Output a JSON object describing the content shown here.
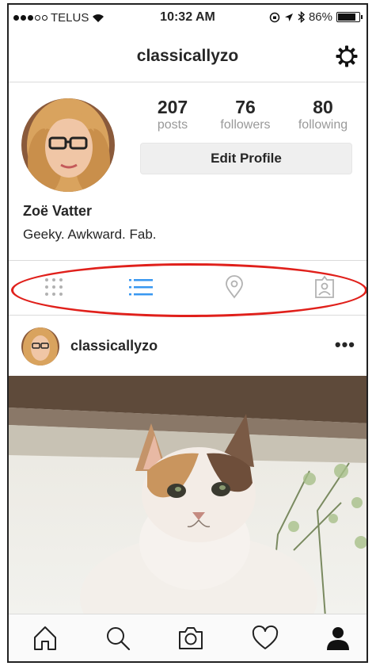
{
  "status_bar": {
    "carrier": "TELUS",
    "signal_bars_filled": 3,
    "signal_bars_total": 5,
    "time": "10:32 AM",
    "battery": "86%",
    "battery_level": 0.86
  },
  "header": {
    "username": "classicallyzo"
  },
  "profile": {
    "stats": [
      {
        "value": "207",
        "label": "posts"
      },
      {
        "value": "76",
        "label": "followers"
      },
      {
        "value": "80",
        "label": "following"
      }
    ],
    "edit_button": "Edit Profile",
    "name": "Zoë Vatter",
    "bio": "Geeky. Awkward. Fab."
  },
  "view_tabs": [
    {
      "icon": "grid-icon",
      "active": false
    },
    {
      "icon": "list-icon",
      "active": true
    },
    {
      "icon": "location-pin-icon",
      "active": false
    },
    {
      "icon": "tagged-person-icon",
      "active": false
    }
  ],
  "post": {
    "username": "classicallyzo",
    "more": "•••"
  },
  "colors": {
    "active_tab": "#3897f0",
    "inactive_tab": "#b2b2b2",
    "highlight": "#e0201b"
  }
}
